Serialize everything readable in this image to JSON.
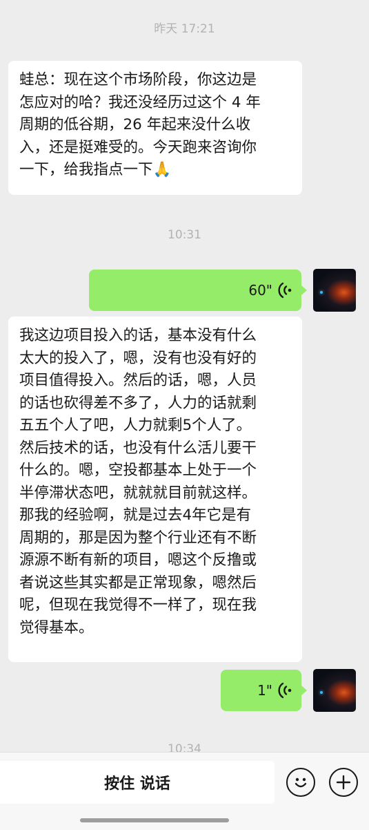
{
  "chat": {
    "timestamps": [
      "昨天 17:21",
      "10:31",
      "10:34"
    ],
    "messages": [
      {
        "sender": "contact",
        "type": "text",
        "text": "蛙总：现在这个市场阶段，你这边是\n怎应对的哈？我还没经历过这个 4 年\n周期的低谷期，26 年起来没什么收\n入，还是挺难受的。今天跑来咨询你\n一下，给我指点一下🙏"
      },
      {
        "sender": "me",
        "type": "voice",
        "duration": "60\""
      },
      {
        "sender": "contact",
        "type": "text",
        "text": "我这边项目投入的话，基本没有什么\n太大的投入了，嗯，没有也没有好的\n项目值得投入。然后的话，嗯，人员\n的话也砍得差不多了，人力的话就剩\n五五个人了吧，人力就剩5个人了。\n然后技术的话，也没有什么活儿要干\n什么的。嗯，空投都基本上处于一个\n半停滞状态吧，就就就目前就这样。\n那我的经验啊，就是过去4年它是有\n周期的，那是因为整个行业还有不断\n源源不断有新的项目，嗯这个反撸或\n者说这些其实都是正常现象，嗯然后\n呢，但现在我觉得不一样了，现在我\n觉得基本。"
      },
      {
        "sender": "me",
        "type": "voice",
        "duration": "1\""
      }
    ]
  },
  "input_bar": {
    "hold_to_talk_label": "按住 说话",
    "emoji_icon": "smiley-face-icon",
    "more_icon": "plus-circle-icon"
  },
  "colors": {
    "background": "#ededed",
    "incoming_bubble": "#ffffff",
    "outgoing_bubble": "#95ec69",
    "timestamp": "#b2b2b2"
  }
}
